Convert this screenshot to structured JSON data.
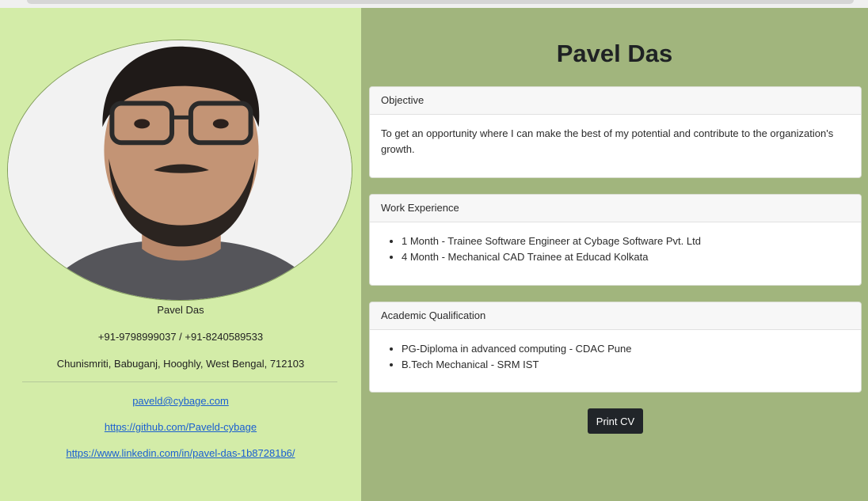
{
  "profile": {
    "name": "Pavel Das",
    "phone": "+91-9798999037 / +91-8240589533",
    "address": "Chunismriti, Babuganj, Hooghly, West Bengal, 712103",
    "email": "paveld@cybage.com",
    "github": "https://github.com/Paveld-cybage",
    "linkedin": "https://www.linkedin.com/in/pavel-das-1b87281b6/"
  },
  "header": {
    "title": "Pavel Das"
  },
  "sections": {
    "objective": {
      "title": "Objective",
      "text": "To get an opportunity where I can make the best of my potential and contribute to the organization's growth."
    },
    "work": {
      "title": "Work Experience",
      "items": [
        "1 Month - Trainee Software Engineer at Cybage Software Pvt. Ltd",
        "4 Month - Mechanical CAD Trainee at Educad Kolkata"
      ]
    },
    "academic": {
      "title": "Academic Qualification",
      "items": [
        "PG-Diploma in advanced computing - CDAC Pune",
        "B.Tech Mechanical - SRM IST"
      ]
    }
  },
  "actions": {
    "print_label": "Print CV"
  },
  "colors": {
    "left_bg": "#d3eca8",
    "right_bg": "#a1b57d",
    "button_bg": "#212529",
    "link": "#1a5fd1"
  }
}
